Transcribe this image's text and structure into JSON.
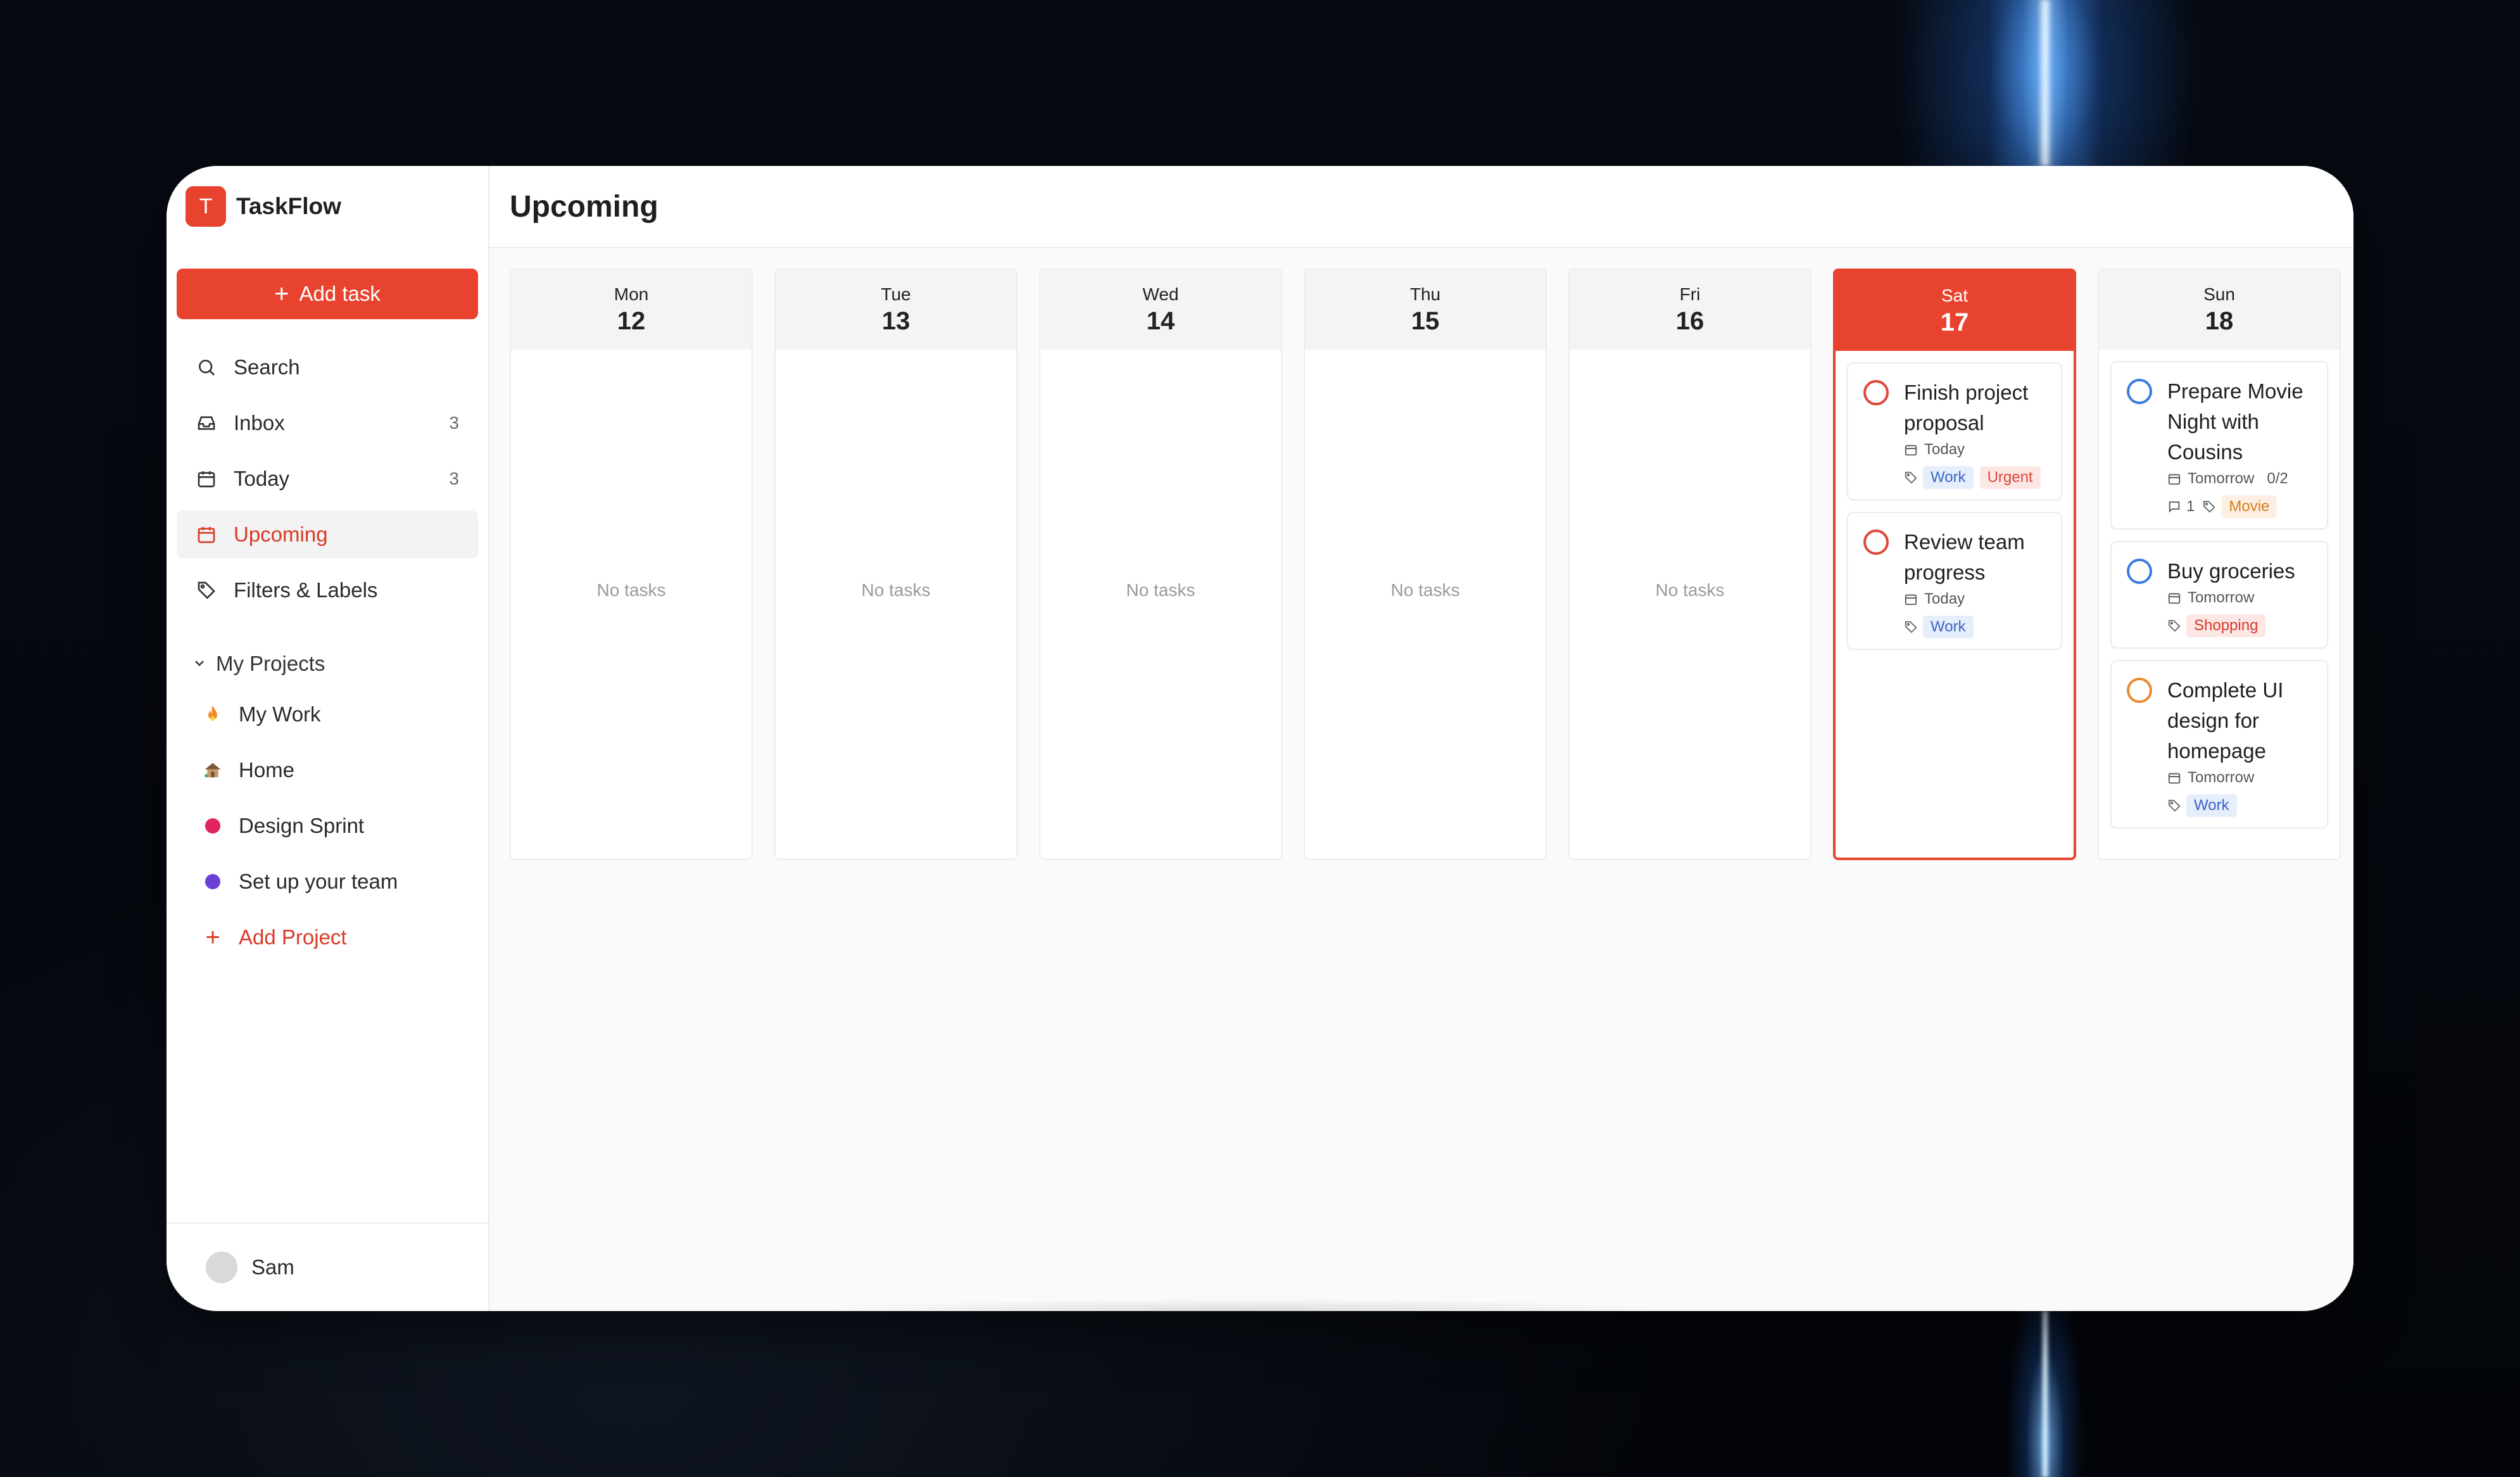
{
  "app": {
    "logo_letter": "T",
    "name": "TaskFlow"
  },
  "sidebar": {
    "add_task_label": "Add task",
    "nav": [
      {
        "label": "Search",
        "count": "",
        "icon": "search-icon"
      },
      {
        "label": "Inbox",
        "count": "3",
        "icon": "inbox-icon"
      },
      {
        "label": "Today",
        "count": "3",
        "icon": "calendar-icon"
      },
      {
        "label": "Upcoming",
        "count": "",
        "icon": "calendar-icon",
        "active": true
      },
      {
        "label": "Filters & Labels",
        "count": "",
        "icon": "tag-icon"
      }
    ],
    "projects_header": "My Projects",
    "projects": [
      {
        "label": "My Work",
        "icon": "fire-emoji-icon"
      },
      {
        "label": "Home",
        "icon": "house-emoji-icon"
      },
      {
        "label": "Design Sprint",
        "icon": "dot-icon",
        "color": "#e0245e"
      },
      {
        "label": "Set up your team",
        "icon": "dot-icon",
        "color": "#6d3fd6"
      }
    ],
    "add_project_label": "Add Project",
    "user": {
      "name": "Sam"
    }
  },
  "main": {
    "title": "Upcoming",
    "empty_label": "No tasks",
    "days": [
      {
        "name": "Mon",
        "num": "12"
      },
      {
        "name": "Tue",
        "num": "13"
      },
      {
        "name": "Wed",
        "num": "14"
      },
      {
        "name": "Thu",
        "num": "15"
      },
      {
        "name": "Fri",
        "num": "16"
      },
      {
        "name": "Sat",
        "num": "17"
      },
      {
        "name": "Sun",
        "num": "18"
      }
    ],
    "sat_tasks": [
      {
        "title": "Finish project proposal",
        "due": "Today",
        "tags": [
          "Work",
          "Urgent"
        ]
      },
      {
        "title": "Review team progress",
        "due": "Today",
        "tags": [
          "Work"
        ]
      }
    ],
    "sun_tasks": [
      {
        "title": "Prepare Movie Night with Cousins",
        "due": "Tomorrow",
        "subtasks": "0/2",
        "comments": "1",
        "tags": [
          "Movie"
        ]
      },
      {
        "title": "Buy groceries",
        "due": "Tomorrow",
        "tags": [
          "Shopping"
        ]
      },
      {
        "title": "Complete UI design for homepage",
        "due": "Tomorrow",
        "tags": [
          "Work"
        ]
      }
    ]
  },
  "colors": {
    "accent": "#e8432f",
    "priority_red": "#e0463a",
    "priority_blue": "#3b7be0",
    "priority_orange": "#e98a2e"
  }
}
